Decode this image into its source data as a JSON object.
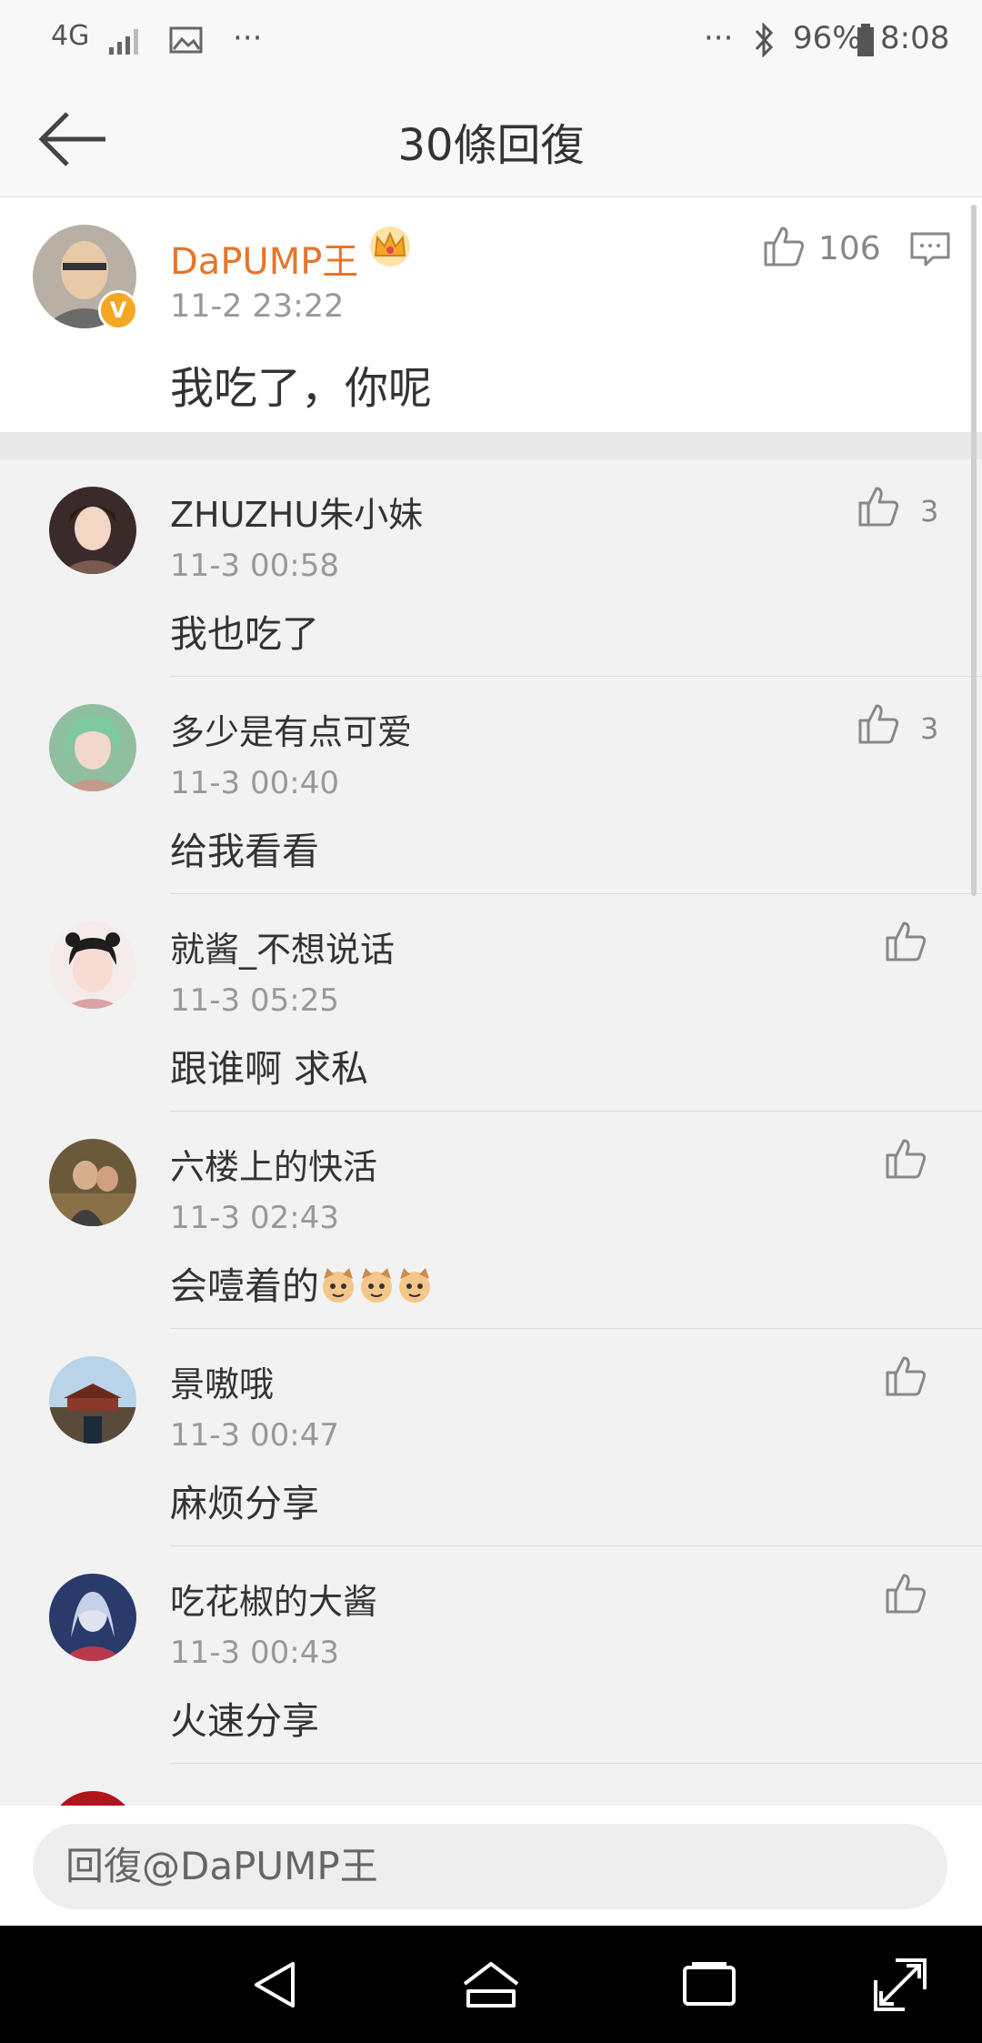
{
  "status_bar": {
    "network": "4G",
    "more_left": "···",
    "more_right": "···",
    "battery": "96%",
    "time": "8:08"
  },
  "header": {
    "title": "30條回復"
  },
  "main_comment": {
    "author": "DaPUMP王",
    "verified_badge": "V",
    "time": "11-2 23:22",
    "text": "我吃了，你呢",
    "likes": "106"
  },
  "replies": [
    {
      "author": "ZHUZHU朱小妹",
      "time": "11-3 00:58",
      "text": "我也吃了",
      "likes": "3"
    },
    {
      "author": "多少是有点可爱",
      "time": "11-3 00:40",
      "text": "给我看看",
      "likes": "3"
    },
    {
      "author": "就酱_不想说话",
      "time": "11-3 05:25",
      "text": "跟谁啊 求私",
      "likes": ""
    },
    {
      "author": "六楼上的快活",
      "time": "11-3 02:43",
      "text": "会噎着的",
      "likes": ""
    },
    {
      "author": "景嗷哦",
      "time": "11-3 00:47",
      "text": "麻烦分享",
      "likes": ""
    },
    {
      "author": "吃花椒的大酱",
      "time": "11-3 00:43",
      "text": "火速分享",
      "likes": ""
    }
  ],
  "reply_input": {
    "placeholder": "回復@DaPUMP王"
  },
  "colors": {
    "author_highlight": "#e5762b",
    "badge": "#f5a623",
    "background": "#f2f2f2"
  }
}
